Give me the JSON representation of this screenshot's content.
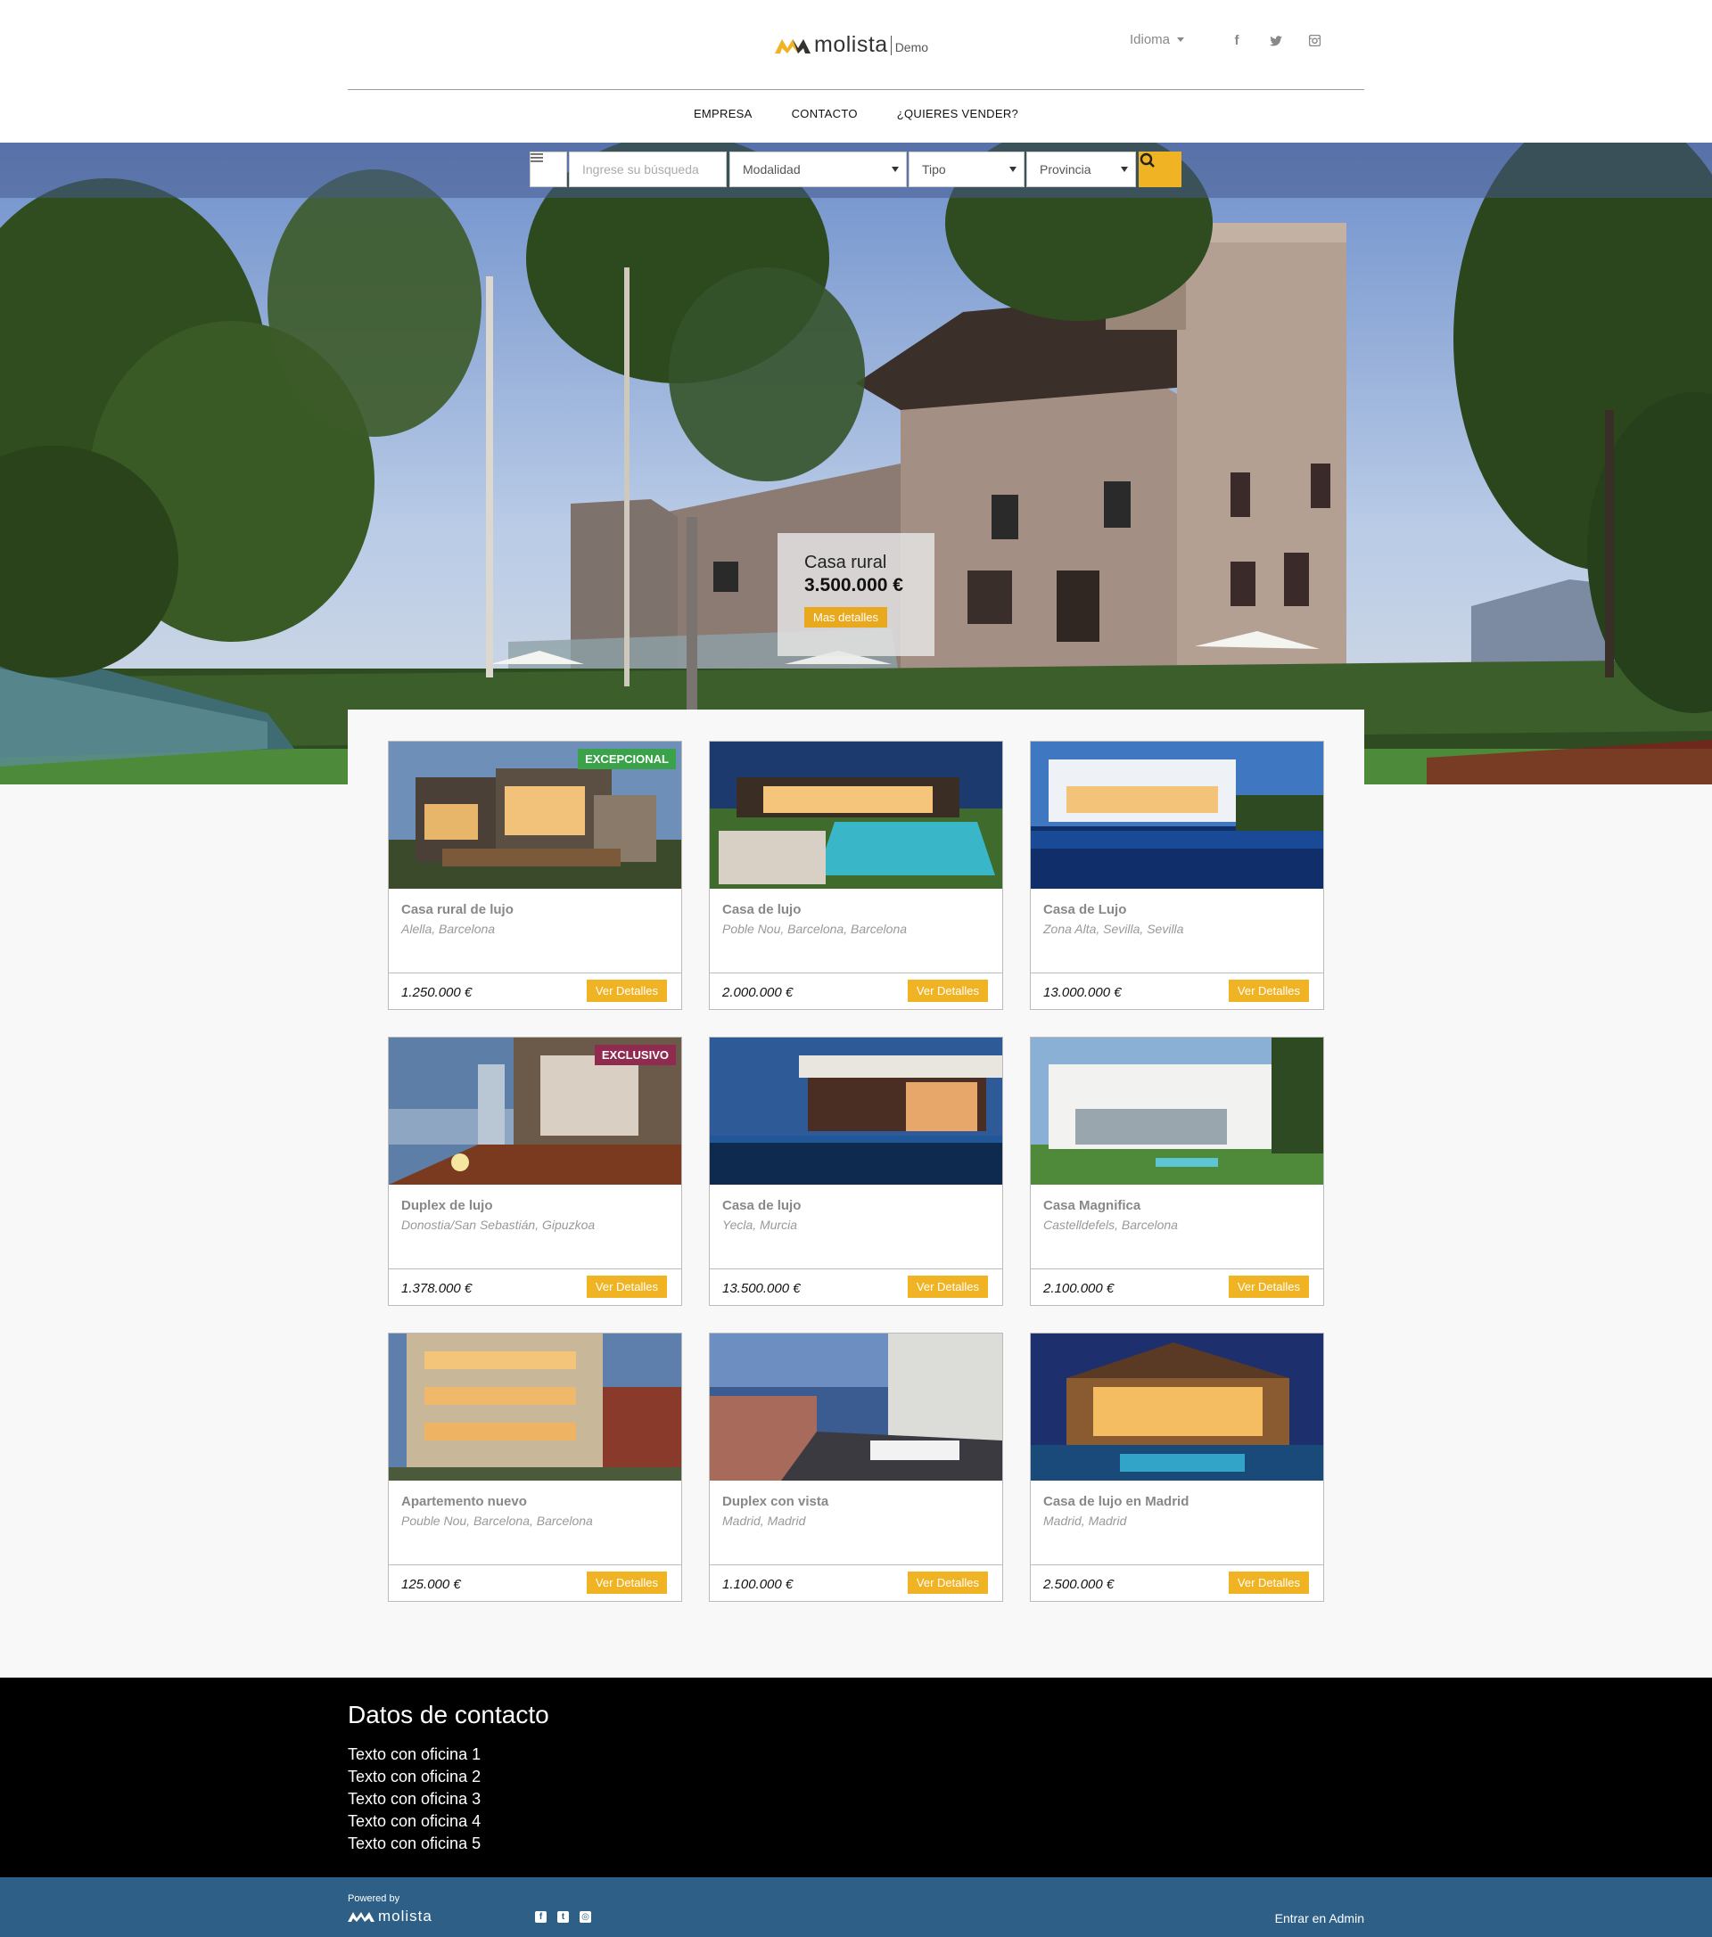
{
  "header": {
    "logo_name": "molista",
    "logo_sub": "Demo",
    "language": "Idioma",
    "social": [
      "facebook-icon",
      "twitter-icon",
      "instagram-icon"
    ]
  },
  "nav": [
    {
      "label": "EMPRESA"
    },
    {
      "label": "CONTACTO"
    },
    {
      "label": "¿QUIERES VENDER?"
    }
  ],
  "search": {
    "placeholder": "Ingrese su búsqueda",
    "modalidad": "Modalidad",
    "tipo": "Tipo",
    "provincia": "Provincia"
  },
  "hero": {
    "type": "Casa rural",
    "price": "3.500.000 €",
    "button": "Mas detalles"
  },
  "listings": [
    {
      "title": "Casa rural de lujo",
      "location": "Alella, Barcelona",
      "price": "1.250.000 €",
      "button": "Ver Detalles",
      "badge": "EXCEPCIONAL",
      "badge_color": "#3aa34a"
    },
    {
      "title": "Casa de lujo",
      "location": "Poble Nou, Barcelona, Barcelona",
      "price": "2.000.000 €",
      "button": "Ver Detalles"
    },
    {
      "title": "Casa de Lujo",
      "location": "Zona Alta, Sevilla, Sevilla",
      "price": "13.000.000 €",
      "button": "Ver Detalles"
    },
    {
      "title": "Duplex de lujo",
      "location": "Donostia/San Sebastián, Gipuzkoa",
      "price": "1.378.000 €",
      "button": "Ver Detalles",
      "badge": "EXCLUSIVO",
      "badge_color": "#8e2b4e"
    },
    {
      "title": "Casa de lujo",
      "location": "Yecla, Murcia",
      "price": "13.500.000 €",
      "button": "Ver Detalles"
    },
    {
      "title": "Casa Magnifica",
      "location": "Castelldefels, Barcelona",
      "price": "2.100.000 €",
      "button": "Ver Detalles"
    },
    {
      "title": "Apartemento nuevo",
      "location": "Pouble Nou, Barcelona, Barcelona",
      "price": "125.000 €",
      "button": "Ver Detalles"
    },
    {
      "title": "Duplex con vista",
      "location": "Madrid, Madrid",
      "price": "1.100.000 €",
      "button": "Ver Detalles"
    },
    {
      "title": "Casa de lujo en Madrid",
      "location": "Madrid, Madrid",
      "price": "2.500.000 €",
      "button": "Ver Detalles"
    }
  ],
  "footer": {
    "heading": "Datos de contacto",
    "lines": [
      "Texto con oficina 1",
      "Texto con oficina 2",
      "Texto con oficina 3",
      "Texto con oficina 4",
      "Texto con oficina 5"
    ]
  },
  "bottom": {
    "powered_by": "Powered by",
    "brand": "molista",
    "admin": "Entrar en Admin"
  },
  "colors": {
    "accent": "#f0b323",
    "footer_bar": "#2e5f86"
  }
}
